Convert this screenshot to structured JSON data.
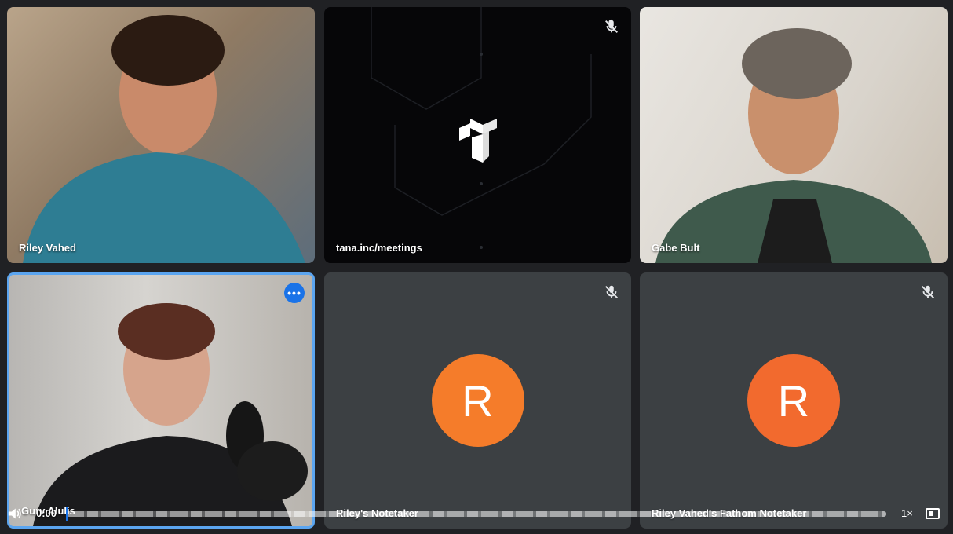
{
  "tiles": [
    {
      "name": "Riley Vahed"
    },
    {
      "name": "tana.inc/meetings"
    },
    {
      "name": "Gabe Bult"
    },
    {
      "name": "Gurv Alulis"
    },
    {
      "name": "Riley's Notetaker",
      "avatar_letter": "R"
    },
    {
      "name": "Riley Vahed's Fathom Notetaker",
      "avatar_letter": "R"
    }
  ],
  "player": {
    "time": "0:00",
    "speed": "1×",
    "progress": 0.0
  },
  "colors": {
    "background": "#202124",
    "tile_gray": "#3c4043",
    "avatar_orange": "#f57c2a",
    "active_border": "#5ba5f0",
    "accent_blue": "#1a73e8"
  },
  "icons": [
    "mic-off-icon",
    "more-options-icon",
    "volume-icon",
    "picture-in-picture-icon",
    "tana-logo"
  ]
}
